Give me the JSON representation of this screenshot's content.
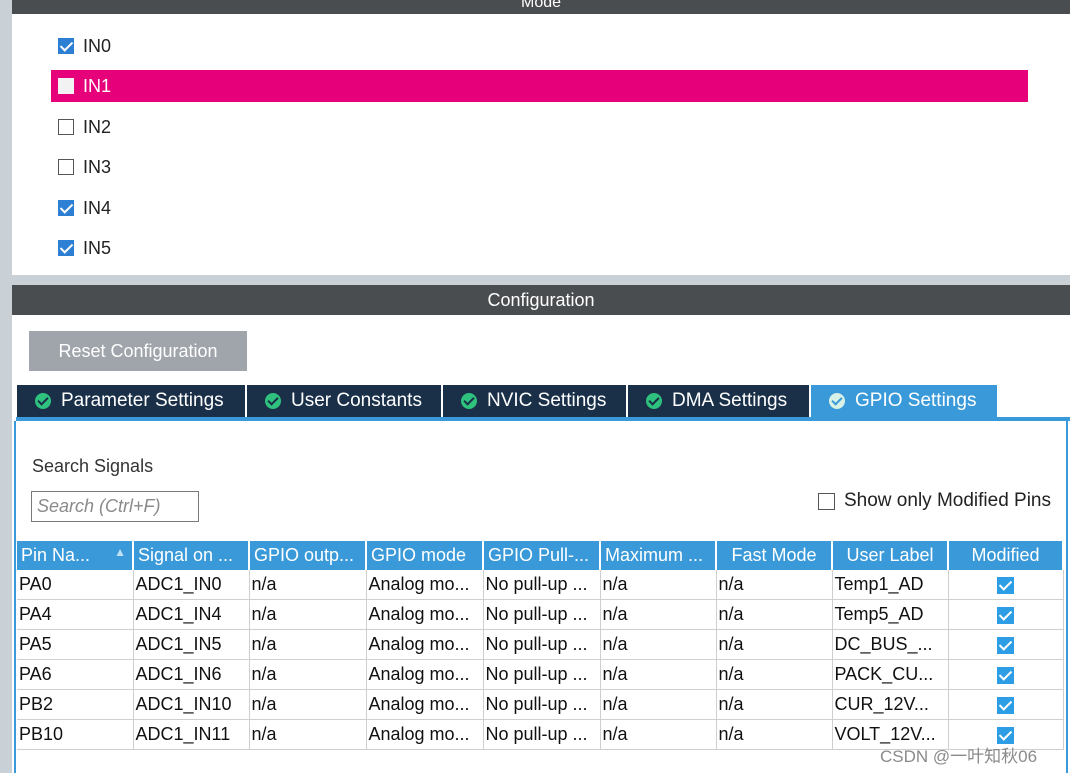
{
  "mode": {
    "header": "Mode",
    "items": [
      {
        "label": "IN0",
        "checked": true
      },
      {
        "label": "IN1",
        "checked": false,
        "selected": true
      },
      {
        "label": "IN2",
        "checked": false
      },
      {
        "label": "IN3",
        "checked": false
      },
      {
        "label": "IN4",
        "checked": true
      },
      {
        "label": "IN5",
        "checked": true
      }
    ]
  },
  "configuration": {
    "header": "Configuration",
    "reset_label": "Reset Configuration",
    "tabs": [
      {
        "label": "Parameter Settings"
      },
      {
        "label": "User Constants"
      },
      {
        "label": "NVIC Settings"
      },
      {
        "label": "DMA Settings"
      },
      {
        "label": "GPIO Settings",
        "active": true
      }
    ],
    "search_label": "Search Signals",
    "search_placeholder": "Search (Ctrl+F)",
    "show_modified_label": "Show only Modified Pins"
  },
  "table": {
    "columns": [
      "Pin Na...",
      "Signal on ...",
      "GPIO outp...",
      "GPIO mode",
      "GPIO Pull-...",
      "Maximum ...",
      "Fast Mode",
      "User Label",
      "Modified"
    ],
    "rows": [
      [
        "PA0",
        "ADC1_IN0",
        "n/a",
        "Analog mo...",
        "No pull-up ...",
        "n/a",
        "n/a",
        "Temp1_AD"
      ],
      [
        "PA4",
        "ADC1_IN4",
        "n/a",
        "Analog mo...",
        "No pull-up ...",
        "n/a",
        "n/a",
        "Temp5_AD"
      ],
      [
        "PA5",
        "ADC1_IN5",
        "n/a",
        "Analog mo...",
        "No pull-up ...",
        "n/a",
        "n/a",
        "DC_BUS_..."
      ],
      [
        "PA6",
        "ADC1_IN6",
        "n/a",
        "Analog mo...",
        "No pull-up ...",
        "n/a",
        "n/a",
        "PACK_CU..."
      ],
      [
        "PB2",
        "ADC1_IN10",
        "n/a",
        "Analog mo...",
        "No pull-up ...",
        "n/a",
        "n/a",
        "CUR_12V..."
      ],
      [
        "PB10",
        "ADC1_IN11",
        "n/a",
        "Analog mo...",
        "No pull-up ...",
        "n/a",
        "n/a",
        "VOLT_12V..."
      ]
    ]
  },
  "watermark": "CSDN @一叶知秋06"
}
